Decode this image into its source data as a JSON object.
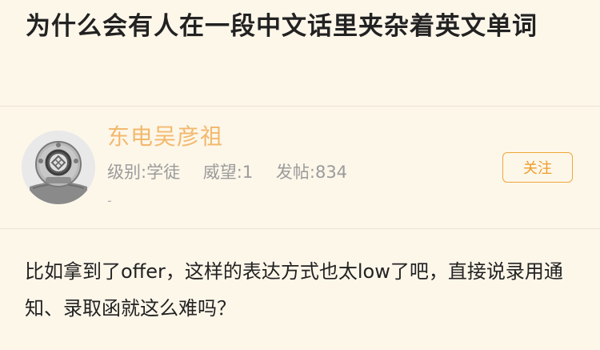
{
  "post": {
    "title": "为什么会有人在一段中文话里夹杂着英文单词",
    "body": "比如拿到了offer，这样的表达方式也太low了吧，直接说录用通知、录取函就这么难吗？"
  },
  "author": {
    "name": "东电吴彦祖",
    "level": "级别:学徒",
    "prestige": "威望:1",
    "posts": "发帖:834",
    "signature": "-",
    "follow_label": "关注",
    "avatar_icon": "diving-helmet-icon"
  },
  "colors": {
    "background": "#fdf7ea",
    "username": "#f2b96e",
    "follow_accent": "#f0a73a",
    "text": "#222222",
    "muted": "#9b9b9b"
  }
}
